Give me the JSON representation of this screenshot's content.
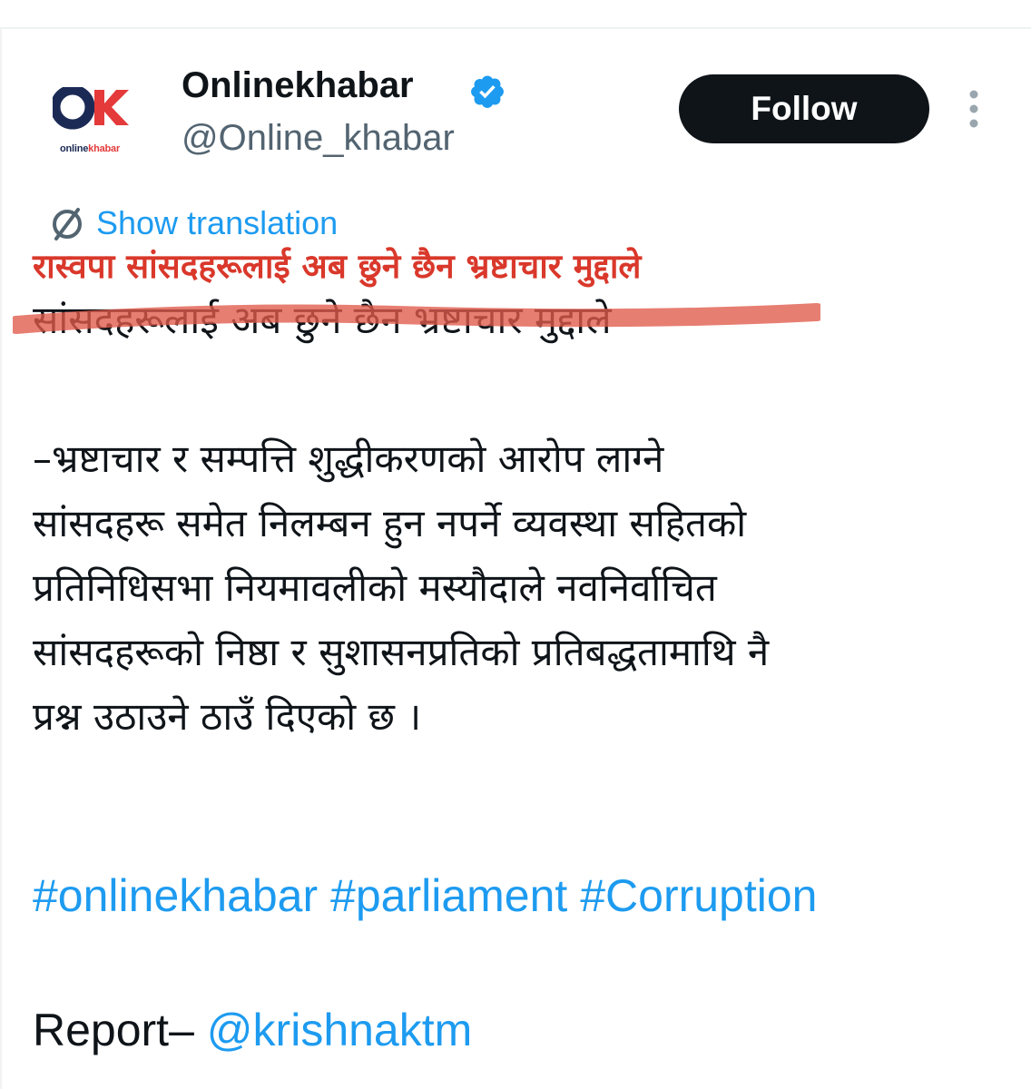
{
  "author": {
    "display_name": "Onlinekhabar",
    "handle": "@Online_khabar",
    "avatar_brand": {
      "prefix": "online",
      "accent": "khabar"
    }
  },
  "actions": {
    "follow_label": "Follow"
  },
  "translation": {
    "label": "Show translation"
  },
  "tweet": {
    "overlay_text": "रास्वपा सांसदहरूलाई अब छुने छैन भ्रष्टाचार मुद्दाले",
    "heading": "सांसदहरूलाई अब छुने छैन भ्रष्टाचार मुद्दाले",
    "paragraph_lines": [
      "–भ्रष्टाचार र सम्पत्ति शुद्धीकरणको आरोप लाग्ने",
      "सांसदहरू समेत निलम्बन हुन नपर्ने व्यवस्था सहितको",
      "प्रतिनिधिसभा नियमावलीको मस्यौदाले नवनिर्वाचित",
      "सांसदहरूको निष्ठा र सुशासनप्रतिको प्रतिबद्धतामाथि नै",
      "प्रश्न उठाउने ठाउँ दिएको छ ।"
    ],
    "hashtags": [
      "#onlinekhabar",
      "#parliament",
      "#Corruption"
    ],
    "report_prefix": "Report–",
    "report_mention": "@krishnaktm"
  },
  "icons": {
    "verified": "verified-badge-icon",
    "more": "more-options-icon",
    "translate": "translate-globe-icon"
  },
  "colors": {
    "link": "#1d9bf0",
    "follow_bg": "#0f1419",
    "verified": "#1d9bf0",
    "overlay_text": "#d9382b",
    "highlight_stroke": "#e05a4a",
    "logo_red": "#e43a3a",
    "logo_navy": "#1b2a55"
  }
}
